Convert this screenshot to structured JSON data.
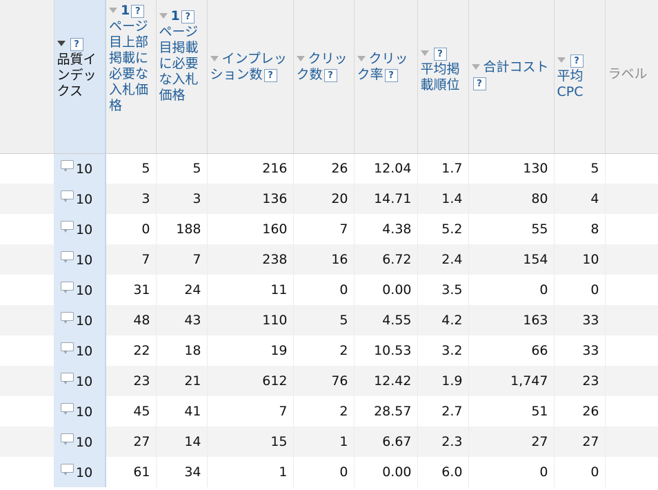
{
  "headers": {
    "quality_index": "品質インデックス",
    "top_bid_num": "1",
    "top_bid": "ページ目上部掲載に必要な入札価格",
    "first_bid_num": "1",
    "first_bid": "ページ目掲載に必要な入札価格",
    "impressions": "インプレッション数",
    "clicks": "クリック数",
    "ctr": "クリック率",
    "avg_pos": "平均掲載順位",
    "cost": "合計コスト",
    "avg_cpc_1": "平均",
    "avg_cpc_2": "CPC",
    "label": "ラベル",
    "help": "?"
  },
  "rows": [
    {
      "qi": "10",
      "top": "5",
      "first": "5",
      "imp": "216",
      "clk": "26",
      "ctr": "12.04",
      "pos": "1.7",
      "cost": "130",
      "cpc": "5"
    },
    {
      "qi": "10",
      "top": "3",
      "first": "3",
      "imp": "136",
      "clk": "20",
      "ctr": "14.71",
      "pos": "1.4",
      "cost": "80",
      "cpc": "4"
    },
    {
      "qi": "10",
      "top": "0",
      "first": "188",
      "imp": "160",
      "clk": "7",
      "ctr": "4.38",
      "pos": "5.2",
      "cost": "55",
      "cpc": "8"
    },
    {
      "qi": "10",
      "top": "7",
      "first": "7",
      "imp": "238",
      "clk": "16",
      "ctr": "6.72",
      "pos": "2.4",
      "cost": "154",
      "cpc": "10"
    },
    {
      "qi": "10",
      "top": "31",
      "first": "24",
      "imp": "11",
      "clk": "0",
      "ctr": "0.00",
      "pos": "3.5",
      "cost": "0",
      "cpc": "0"
    },
    {
      "qi": "10",
      "top": "48",
      "first": "43",
      "imp": "110",
      "clk": "5",
      "ctr": "4.55",
      "pos": "4.2",
      "cost": "163",
      "cpc": "33"
    },
    {
      "qi": "10",
      "top": "22",
      "first": "18",
      "imp": "19",
      "clk": "2",
      "ctr": "10.53",
      "pos": "3.2",
      "cost": "66",
      "cpc": "33"
    },
    {
      "qi": "10",
      "top": "23",
      "first": "21",
      "imp": "612",
      "clk": "76",
      "ctr": "12.42",
      "pos": "1.9",
      "cost": "1,747",
      "cpc": "23"
    },
    {
      "qi": "10",
      "top": "45",
      "first": "41",
      "imp": "7",
      "clk": "2",
      "ctr": "28.57",
      "pos": "2.7",
      "cost": "51",
      "cpc": "26"
    },
    {
      "qi": "10",
      "top": "27",
      "first": "14",
      "imp": "15",
      "clk": "1",
      "ctr": "6.67",
      "pos": "2.3",
      "cost": "27",
      "cpc": "27"
    },
    {
      "qi": "10",
      "top": "61",
      "first": "34",
      "imp": "1",
      "clk": "0",
      "ctr": "0.00",
      "pos": "6.0",
      "cost": "0",
      "cpc": "0"
    }
  ]
}
